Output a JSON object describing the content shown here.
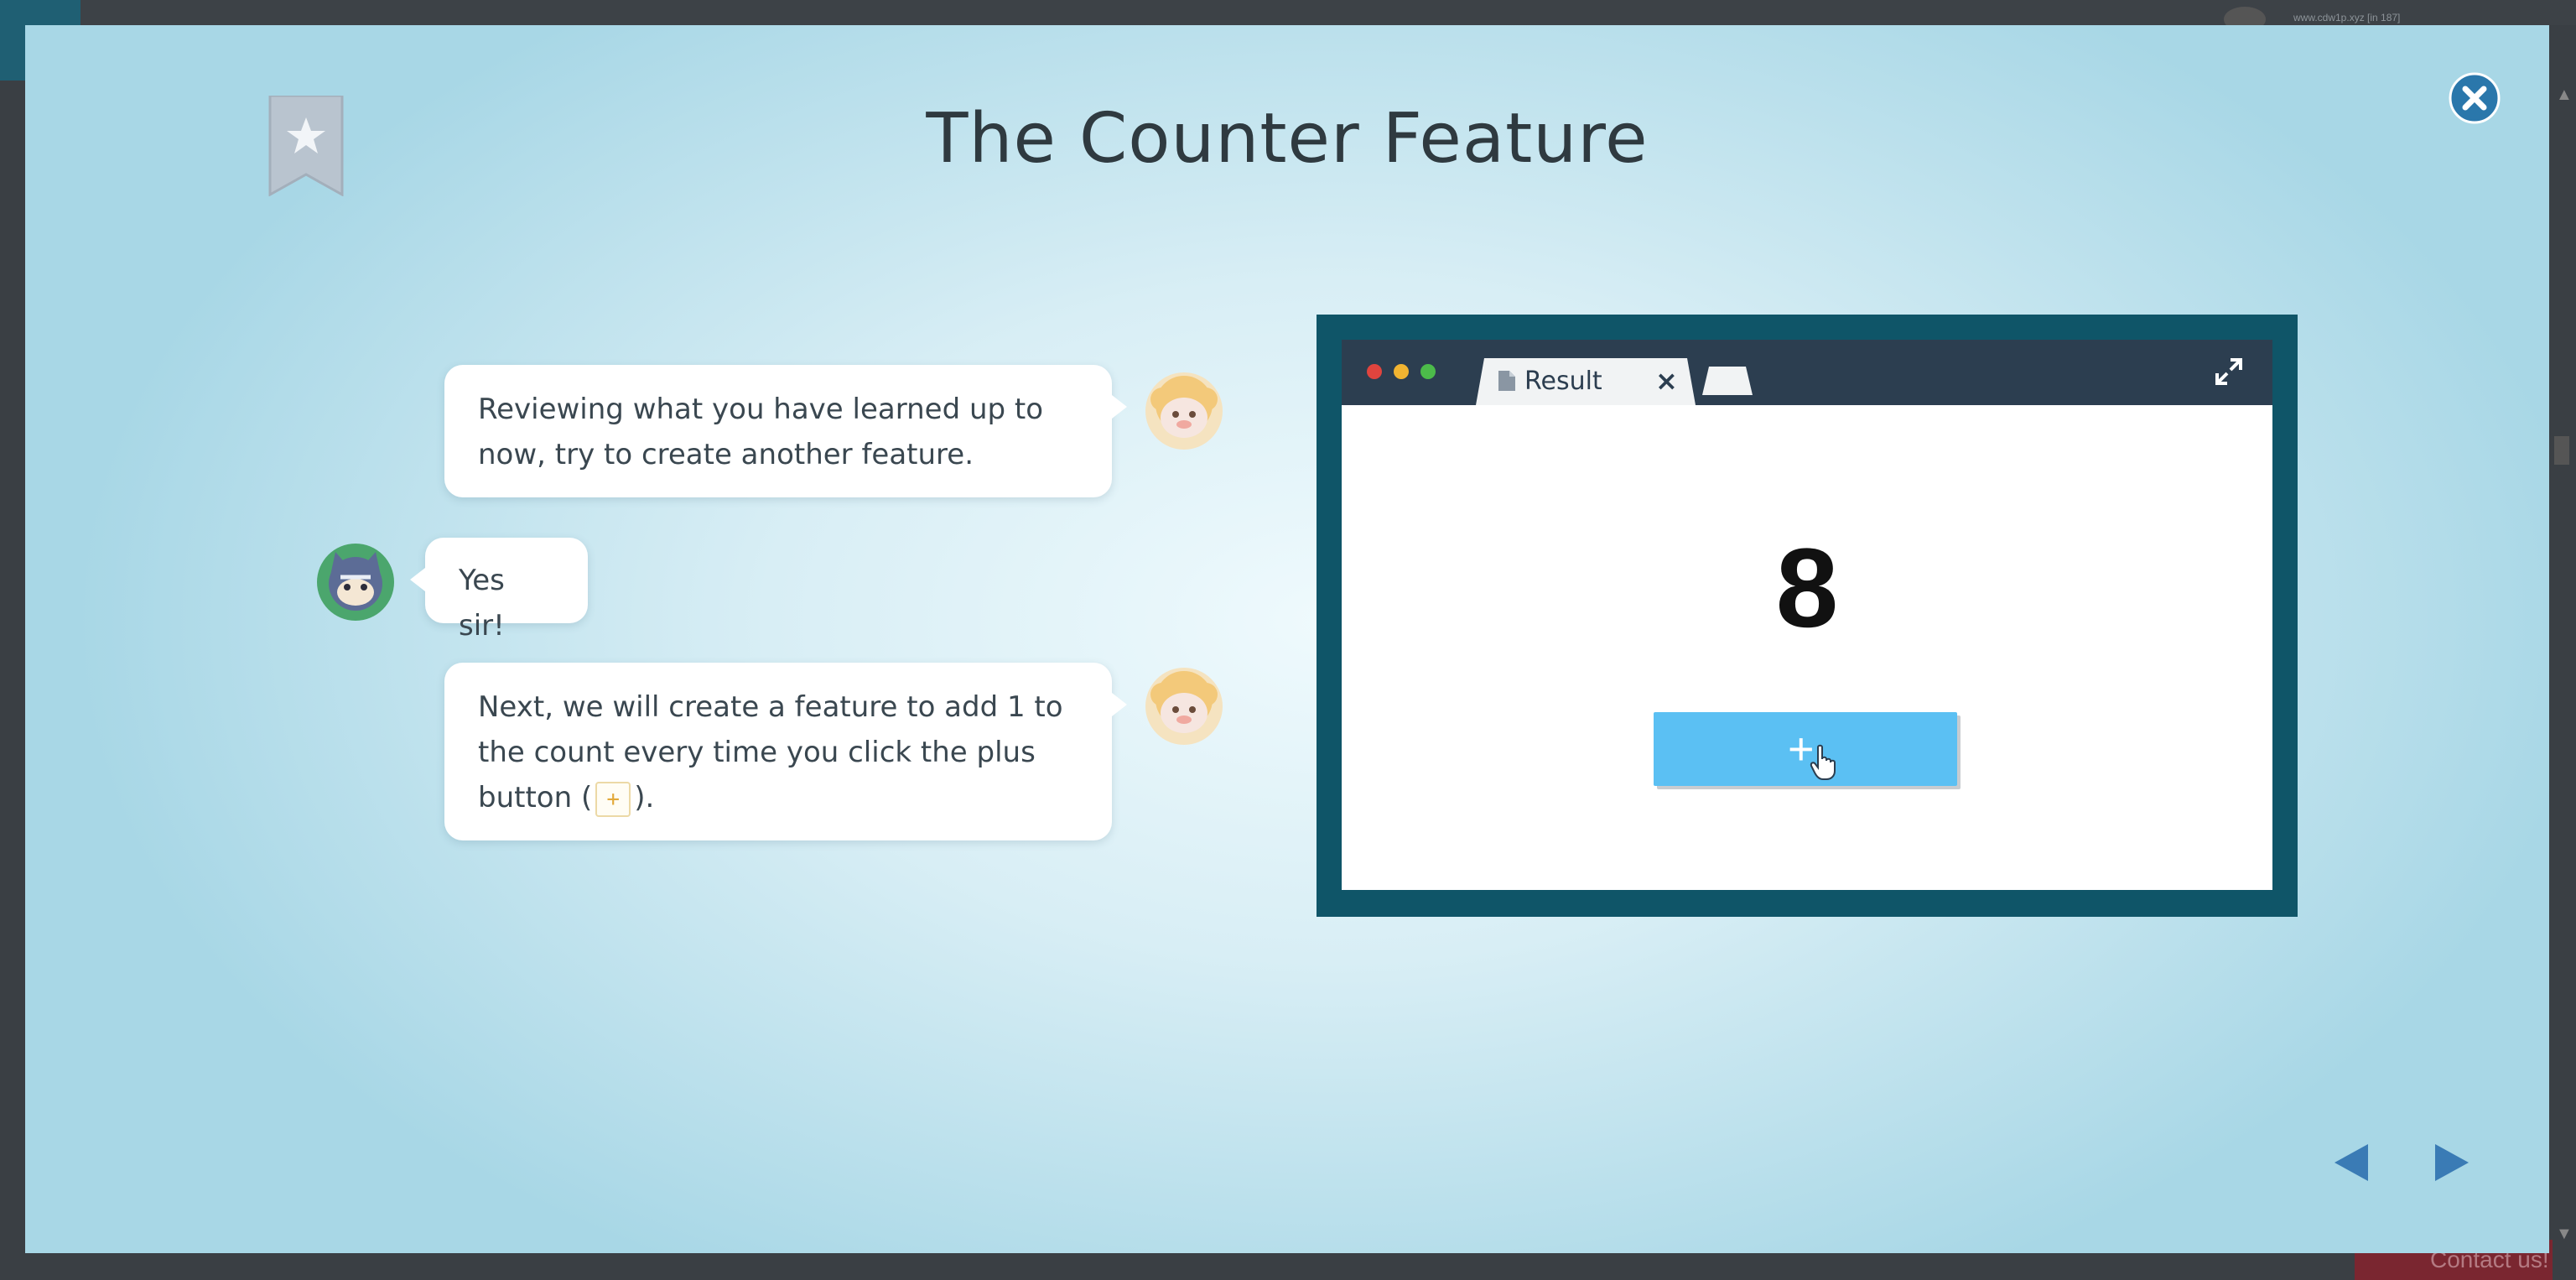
{
  "background": {
    "url_text": "www.cdw1p.xyz [in 187]",
    "contact_label": "Contact us!"
  },
  "modal": {
    "title": "The Counter Feature",
    "close_icon": "close-icon",
    "bookmark_icon": "bookmark-star-icon"
  },
  "chat": {
    "messages": [
      {
        "speaker": "sheep-teacher",
        "text": "Reviewing what you have learned up to now, try to create another feature."
      },
      {
        "speaker": "cat-student",
        "text": "Yes sir!"
      },
      {
        "speaker": "sheep-teacher",
        "text_before": "Next, we will create a feature to add 1 to the count every time you click the plus button (",
        "chip": "+",
        "text_after": ")."
      }
    ]
  },
  "result_window": {
    "tab_label": "Result",
    "tab_close": "×",
    "counter_value": "8",
    "button_glyph": "+",
    "colors": {
      "frame": "#0f5568",
      "titlebar": "#2c3e50",
      "button": "#5bc0f3"
    }
  },
  "nav": {
    "prev_icon": "arrow-left-icon",
    "next_icon": "arrow-right-icon"
  }
}
